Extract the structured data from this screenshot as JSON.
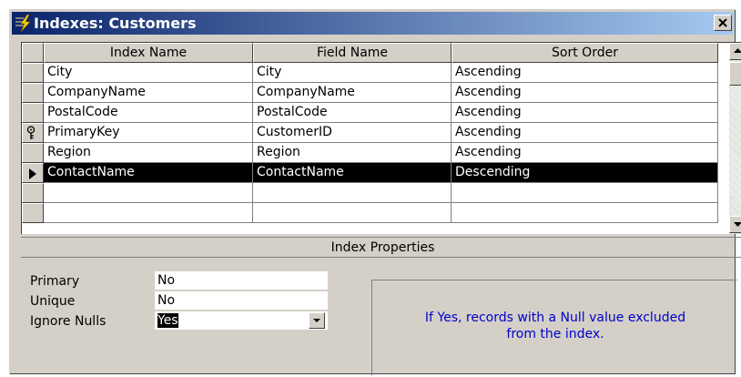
{
  "window": {
    "title": "Indexes: Customers"
  },
  "grid": {
    "columns": [
      "Index Name",
      "Field Name",
      "Sort Order"
    ],
    "rows": [
      {
        "index_name": "City",
        "field_name": "City",
        "sort_order": "Ascending",
        "indicator": ""
      },
      {
        "index_name": "CompanyName",
        "field_name": "CompanyName",
        "sort_order": "Ascending",
        "indicator": ""
      },
      {
        "index_name": "PostalCode",
        "field_name": "PostalCode",
        "sort_order": "Ascending",
        "indicator": ""
      },
      {
        "index_name": "PrimaryKey",
        "field_name": "CustomerID",
        "sort_order": "Ascending",
        "indicator": "key-icon"
      },
      {
        "index_name": "Region",
        "field_name": "Region",
        "sort_order": "Ascending",
        "indicator": ""
      },
      {
        "index_name": "ContactName",
        "field_name": "ContactName",
        "sort_order": "Descending",
        "indicator": "current-row-arrow-icon"
      },
      {
        "index_name": "",
        "field_name": "",
        "sort_order": "",
        "indicator": ""
      }
    ]
  },
  "properties": {
    "header": "Index Properties",
    "primary_label": "Primary",
    "primary_value": "No",
    "unique_label": "Unique",
    "unique_value": "No",
    "ignore_nulls_label": "Ignore Nulls",
    "ignore_nulls_value": "Yes",
    "help_line1": "If Yes, records with a Null value excluded",
    "help_line2": "from the index."
  },
  "colors": {
    "title_start": "#0a246a",
    "title_end": "#a6caf0",
    "help_text": "#0000cc",
    "face": "#d4d0c8"
  }
}
